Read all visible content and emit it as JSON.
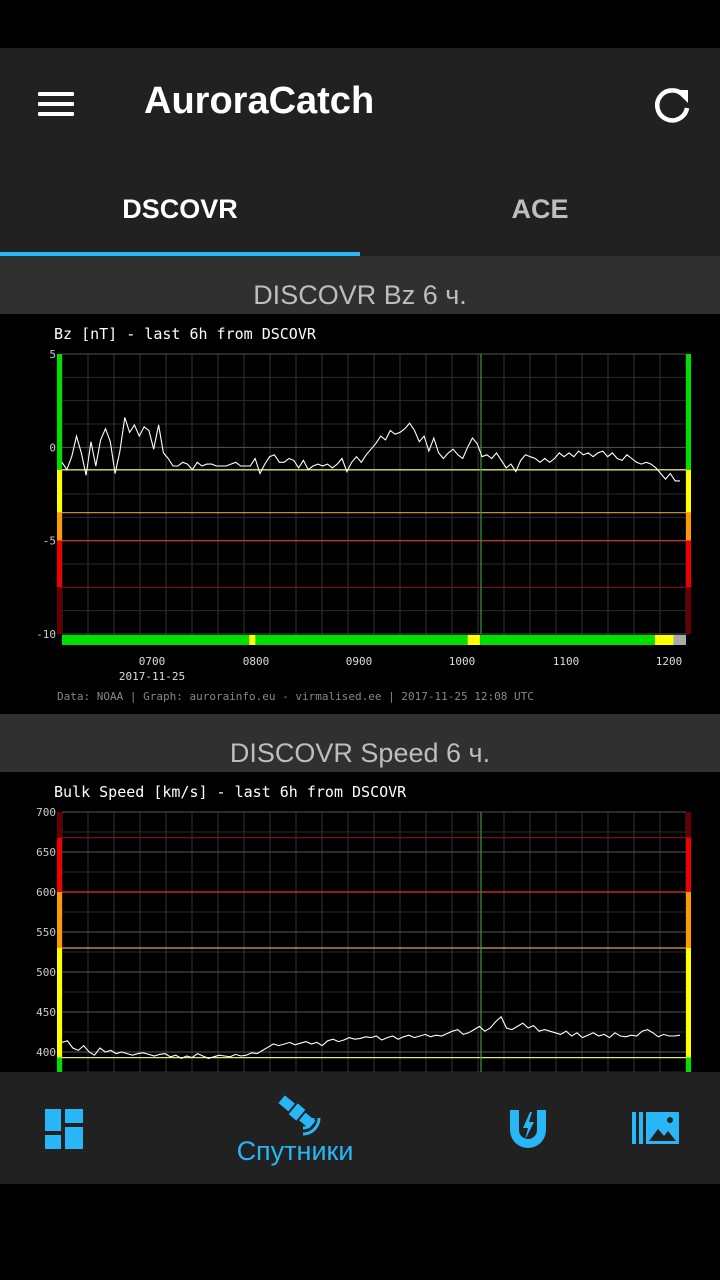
{
  "app": {
    "title": "AuroraCatch"
  },
  "tabs": [
    {
      "label": "DSCOVR",
      "active": true
    },
    {
      "label": "ACE",
      "active": false
    }
  ],
  "sections": {
    "bz": {
      "title": "DISCOVR Bz 6 ч."
    },
    "speed": {
      "title": "DISCOVR Speed 6 ч."
    }
  },
  "chart_data": [
    {
      "type": "line",
      "title": "Bz [nT] - last 6h from DSCOVR",
      "ylabel": "",
      "xlabel": "",
      "ylim": [
        -10,
        5
      ],
      "y_ticks": [
        "5",
        "0",
        "-5",
        "-10"
      ],
      "x_ticks": [
        "0700",
        "0800",
        "0900",
        "1000",
        "1100",
        "1200"
      ],
      "date_label": "2017-11-25",
      "footer": "Data: NOAA | Graph: aurorainfo.eu - virmalised.ee | 2017-11-25 12:08 UTC",
      "grid": true,
      "reference_lines": [
        -1.2,
        -3.5,
        -5,
        -7.5
      ],
      "series": [
        {
          "values": [
            -0.8,
            -1.2,
            -0.5,
            0.6,
            -0.3,
            -1.5,
            0.3,
            -1.0,
            0.4,
            1.0,
            0.3,
            -1.4,
            -0.2,
            1.6,
            0.8,
            1.2,
            0.6,
            1.1,
            0.9,
            -0.1,
            1.2,
            -0.3,
            -0.6,
            -1.0,
            -1.0,
            -0.8,
            -0.9,
            -1.2,
            -0.8,
            -1.0,
            -0.9,
            -0.9,
            -1.0,
            -1.0,
            -1.0,
            -0.9,
            -0.8,
            -1.0,
            -1.0,
            -1.0,
            -0.6,
            -1.4,
            -0.9,
            -0.5,
            -0.4,
            -0.8,
            -0.8,
            -0.6,
            -0.7,
            -1.1,
            -0.7,
            -1.2,
            -1.0,
            -0.9,
            -1.0,
            -0.9,
            -1.1,
            -0.9,
            -0.6,
            -1.3,
            -0.8,
            -0.5,
            -0.8,
            -0.4,
            -0.1,
            0.2,
            0.6,
            0.4,
            0.9,
            0.7,
            0.8,
            1.0,
            1.3,
            0.9,
            0.3,
            0.6,
            -0.2,
            0.5,
            -0.3,
            -0.6,
            -0.3,
            -0.1,
            -0.4,
            -0.6,
            0.0,
            0.5,
            0.2,
            -0.5,
            -0.4,
            -0.6,
            -0.3,
            -0.7,
            -1.1,
            -0.9,
            -1.3,
            -0.7,
            -0.4,
            -0.5,
            -0.6,
            -0.8,
            -0.6,
            -0.8,
            -0.6,
            -0.3,
            -0.5,
            -0.3,
            -0.5,
            -0.2,
            -0.4,
            -0.3,
            -0.5,
            -0.3,
            -0.2,
            -0.5,
            -0.3,
            -0.6,
            -0.7,
            -0.4,
            -0.6,
            -0.8,
            -0.9,
            -0.8,
            -0.9,
            -1.1,
            -1.4,
            -1.7,
            -1.4,
            -1.8,
            -1.8
          ]
        }
      ],
      "status_bar": [
        {
          "from": 0.0,
          "to": 0.3,
          "color": "#00e000"
        },
        {
          "from": 0.3,
          "to": 0.31,
          "color": "#ffff00"
        },
        {
          "from": 0.31,
          "to": 0.65,
          "color": "#00e000"
        },
        {
          "from": 0.65,
          "to": 0.67,
          "color": "#ffff00"
        },
        {
          "from": 0.67,
          "to": 0.95,
          "color": "#00e000"
        },
        {
          "from": 0.95,
          "to": 0.98,
          "color": "#ffff00"
        },
        {
          "from": 0.98,
          "to": 1.0,
          "color": "#aaaaaa"
        }
      ]
    },
    {
      "type": "line",
      "title": "Bulk Speed [km/s] - last 6h from DSCOVR",
      "ylabel": "",
      "xlabel": "",
      "ylim": [
        375,
        700
      ],
      "y_ticks": [
        "700",
        "650",
        "600",
        "550",
        "500",
        "450",
        "400"
      ],
      "grid": true,
      "reference_lines": [
        393,
        530,
        600,
        668
      ],
      "series": [
        {
          "values": [
            412,
            414,
            405,
            402,
            408,
            400,
            396,
            405,
            400,
            402,
            398,
            400,
            398,
            396,
            398,
            399,
            397,
            395,
            397,
            398,
            394,
            396,
            392,
            395,
            393,
            398,
            395,
            392,
            394,
            396,
            395,
            394,
            397,
            395,
            396,
            399,
            398,
            402,
            406,
            410,
            408,
            410,
            412,
            409,
            411,
            413,
            410,
            412,
            408,
            414,
            416,
            413,
            415,
            418,
            416,
            417,
            419,
            418,
            420,
            415,
            418,
            420,
            416,
            419,
            421,
            418,
            420,
            422,
            419,
            421,
            420,
            423,
            426,
            428,
            422,
            424,
            428,
            432,
            426,
            430,
            438,
            444,
            430,
            428,
            432,
            436,
            430,
            433,
            426,
            428,
            426,
            424,
            422,
            426,
            420,
            424,
            418,
            421,
            424,
            420,
            422,
            418,
            424,
            420,
            419,
            421,
            420,
            426,
            428,
            424,
            419,
            422,
            420,
            420,
            421
          ]
        }
      ]
    }
  ],
  "bottom_nav": [
    {
      "icon": "dashboard-icon",
      "label": ""
    },
    {
      "icon": "satellite-icon",
      "label": "Спутники",
      "active": true
    },
    {
      "icon": "magnet-icon",
      "label": ""
    },
    {
      "icon": "gallery-icon",
      "label": ""
    }
  ],
  "colors": {
    "accent": "#29b6f6",
    "appbar": "#212121",
    "content_bg": "#303030"
  }
}
